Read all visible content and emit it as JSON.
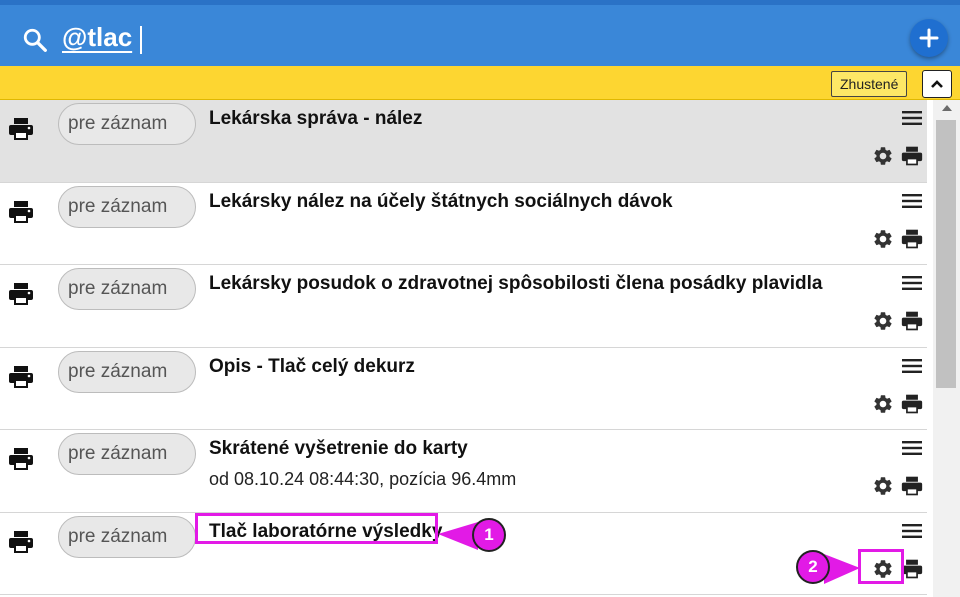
{
  "search": {
    "query": "@tlac"
  },
  "filter_bar": {
    "compact_label": "Zhustené"
  },
  "rows": [
    {
      "record_label": "pre záznam",
      "title": "Lekárska správa - nález",
      "subtitle": "",
      "selected": true
    },
    {
      "record_label": "pre záznam",
      "title": "Lekársky nález na účely štátnych sociálnych dávok",
      "subtitle": ""
    },
    {
      "record_label": "pre záznam",
      "title": "Lekársky posudok o zdravotnej spôsobilosti člena posádky plavidla",
      "subtitle": ""
    },
    {
      "record_label": "pre záznam",
      "title": "Opis - Tlač celý dekurz",
      "subtitle": ""
    },
    {
      "record_label": "pre záznam",
      "title": "Skrátené vyšetrenie do karty",
      "subtitle": "od 08.10.24 08:44:30, pozícia 96.4mm"
    },
    {
      "record_label": "pre záznam",
      "title": "Tlač laboratórne výsledky",
      "subtitle": ""
    }
  ],
  "annotations": {
    "callout_1": "1",
    "callout_2": "2",
    "color": "#e21ae6"
  },
  "colors": {
    "header": "#3a87d8",
    "filter_bar": "#fdd631",
    "selected_row": "#e2e2e2"
  },
  "icons": {
    "search": "search-icon",
    "add": "plus-icon",
    "print": "printer-icon",
    "menu": "hamburger-icon",
    "settings": "gear-icon",
    "collapse": "chevron-up-icon"
  }
}
